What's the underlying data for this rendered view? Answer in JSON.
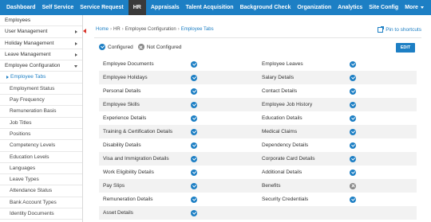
{
  "topnav": {
    "items": [
      {
        "label": "Dashboard"
      },
      {
        "label": "Self Service"
      },
      {
        "label": "Service Request"
      },
      {
        "label": "HR",
        "active": true
      },
      {
        "label": "Appraisals"
      },
      {
        "label": "Talent Acquisition"
      },
      {
        "label": "Background Check"
      },
      {
        "label": "Organization"
      },
      {
        "label": "Analytics"
      },
      {
        "label": "Site Config"
      },
      {
        "label": "More"
      }
    ]
  },
  "sidebar": {
    "items": [
      {
        "label": "Employees"
      },
      {
        "label": "User Management"
      },
      {
        "label": "Holiday Management"
      },
      {
        "label": "Leave Management"
      },
      {
        "label": "Employee Configuration"
      },
      {
        "label": "Employee Tabs"
      },
      {
        "label": "Employment Status"
      },
      {
        "label": "Pay Frequency"
      },
      {
        "label": "Remuneration Basis"
      },
      {
        "label": "Job Titles"
      },
      {
        "label": "Positions"
      },
      {
        "label": "Competency Levels"
      },
      {
        "label": "Education Levels"
      },
      {
        "label": "Languages"
      },
      {
        "label": "Leave Types"
      },
      {
        "label": "Attendance Status"
      },
      {
        "label": "Bank Account Types"
      },
      {
        "label": "Identity Documents"
      }
    ]
  },
  "breadcrumb": {
    "home": "Home",
    "hr": "HR",
    "config": "Employee Configuration",
    "current": "Employee Tabs"
  },
  "pin_label": "Pin to shortcuts",
  "legend": {
    "configured": "Configured",
    "not_configured": "Not Configured"
  },
  "edit_label": "EDIT",
  "tabs_left": [
    {
      "label": "Employee Documents",
      "status": "configured"
    },
    {
      "label": "Employee Holidays",
      "status": "configured"
    },
    {
      "label": "Personal Details",
      "status": "configured"
    },
    {
      "label": "Employee Skills",
      "status": "configured"
    },
    {
      "label": "Experience Details",
      "status": "configured"
    },
    {
      "label": "Training & Certification Details",
      "status": "configured"
    },
    {
      "label": "Disability Details",
      "status": "configured"
    },
    {
      "label": "Visa and Immigration Details",
      "status": "configured"
    },
    {
      "label": "Work Eligibility Details",
      "status": "configured"
    },
    {
      "label": "Pay Slips",
      "status": "configured"
    },
    {
      "label": "Remuneration Details",
      "status": "configured"
    },
    {
      "label": "Asset Details",
      "status": "configured"
    }
  ],
  "tabs_right": [
    {
      "label": "Employee Leaves",
      "status": "configured"
    },
    {
      "label": "Salary Details",
      "status": "configured"
    },
    {
      "label": "Contact Details",
      "status": "configured"
    },
    {
      "label": "Employee Job History",
      "status": "configured"
    },
    {
      "label": "Education Details",
      "status": "configured"
    },
    {
      "label": "Medical Claims",
      "status": "configured"
    },
    {
      "label": "Dependency Details",
      "status": "configured"
    },
    {
      "label": "Corporate Card Details",
      "status": "configured"
    },
    {
      "label": "Additional Details",
      "status": "configured"
    },
    {
      "label": "Benefits",
      "status": "not_configured"
    },
    {
      "label": "Security Credentials",
      "status": "configured"
    }
  ]
}
